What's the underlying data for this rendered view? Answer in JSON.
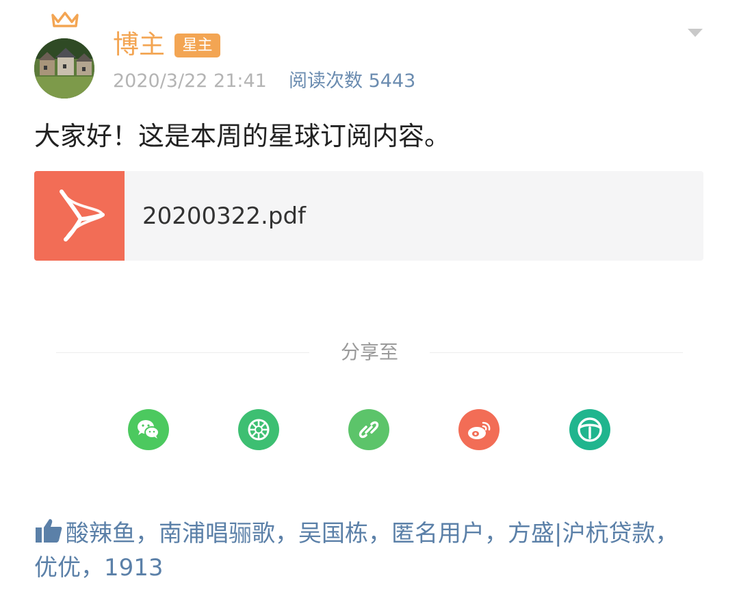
{
  "post": {
    "author": {
      "name": "博主",
      "badge": "星主",
      "avatar_icon": "crown-avatar"
    },
    "timestamp": "2020/3/22 21:41",
    "read_label": "阅读次数",
    "read_count": "5443",
    "read_text": "阅读次数 5443",
    "content": "大家好！这是本周的星球订阅内容。",
    "attachment": {
      "file_name": "20200322.pdf",
      "icon": "pdf-icon",
      "color": "#f26d56"
    }
  },
  "share": {
    "label": "分享至",
    "targets": [
      {
        "name": "wechat",
        "icon": "wechat-icon",
        "color": "#4cc95f"
      },
      {
        "name": "moments",
        "icon": "moments-icon",
        "color": "#3dbf72"
      },
      {
        "name": "link",
        "icon": "link-icon",
        "color": "#5cc46a"
      },
      {
        "name": "weibo",
        "icon": "weibo-icon",
        "color": "#f26d56"
      },
      {
        "name": "other",
        "icon": "share-app-icon",
        "color": "#20b58e"
      }
    ]
  },
  "likes": {
    "icon": "thumbs-up-icon",
    "text": "酸辣鱼，南浦唱骊歌，吴国栋，匿名用户，方盛|沪杭贷款，优优，1913"
  },
  "colors": {
    "accent_orange": "#f3a553",
    "link_blue": "#5b80a8",
    "pdf_red": "#f26d56"
  }
}
